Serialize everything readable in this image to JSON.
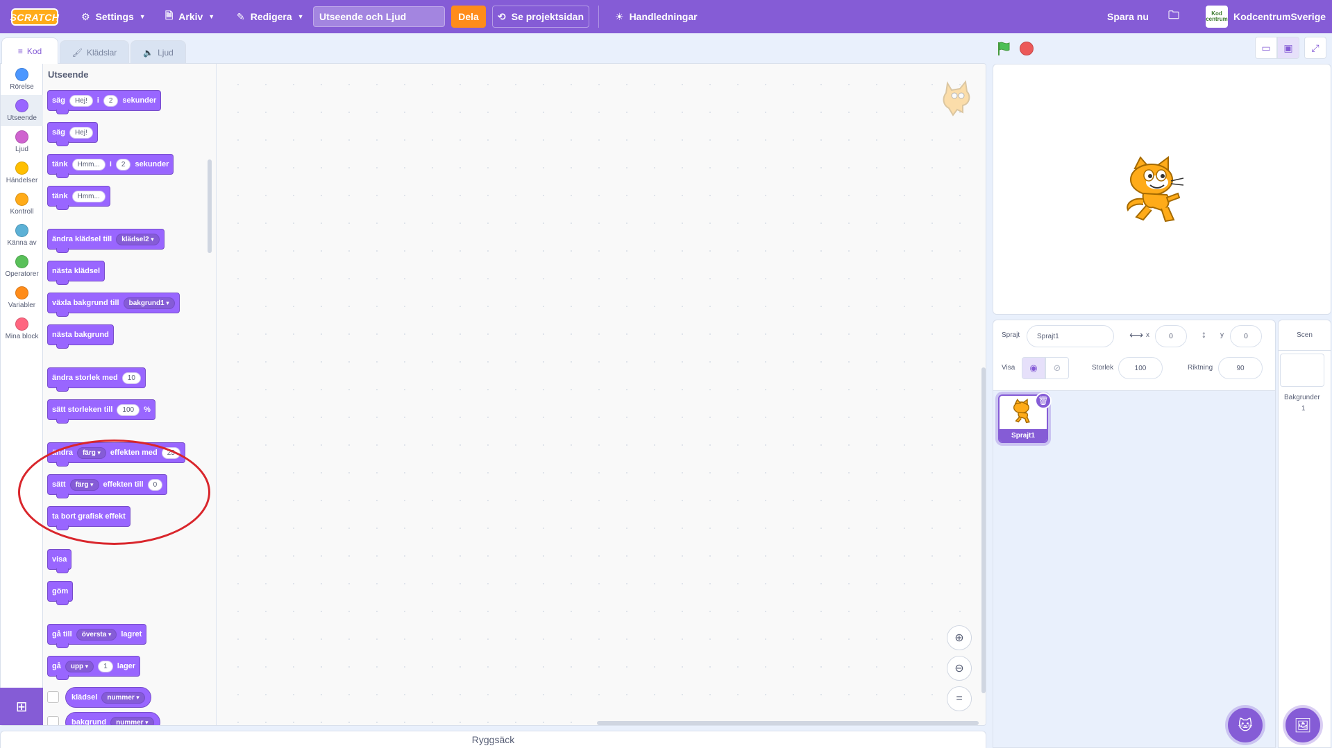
{
  "menubar": {
    "logo": "SCRATCH",
    "settings": "Settings",
    "file": "Arkiv",
    "edit": "Redigera",
    "project_title": "Utseende och Ljud",
    "share": "Dela",
    "see_project_page": "Se projektsidan",
    "tutorials": "Handledningar",
    "save_now": "Spara nu",
    "account_name": "KodcentrumSverige",
    "avatar_text": "Kod centrum"
  },
  "tabs": {
    "code": "Kod",
    "costumes": "Klädslar",
    "sounds": "Ljud"
  },
  "categories": [
    {
      "label": "Rörelse",
      "color": "#4c97ff"
    },
    {
      "label": "Utseende",
      "color": "#9966ff"
    },
    {
      "label": "Ljud",
      "color": "#cf63cf"
    },
    {
      "label": "Händelser",
      "color": "#ffbf00"
    },
    {
      "label": "Kontroll",
      "color": "#ffab19"
    },
    {
      "label": "Känna av",
      "color": "#5cb1d6"
    },
    {
      "label": "Operatorer",
      "color": "#59c059"
    },
    {
      "label": "Variabler",
      "color": "#ff8c1a"
    },
    {
      "label": "Mina block",
      "color": "#ff6680"
    }
  ],
  "flyout": {
    "title": "Utseende",
    "blocks": {
      "say_for": {
        "say": "säg",
        "msg": "Hej!",
        "in": "i",
        "secs": "2",
        "seconds": "sekunder"
      },
      "say": {
        "say": "säg",
        "msg": "Hej!"
      },
      "think_for": {
        "think": "tänk",
        "msg": "Hmm...",
        "in": "i",
        "secs": "2",
        "seconds": "sekunder"
      },
      "think": {
        "think": "tänk",
        "msg": "Hmm..."
      },
      "switch_costume": {
        "label": "ändra klädsel till",
        "value": "klädsel2"
      },
      "next_costume": {
        "label": "nästa klädsel"
      },
      "switch_backdrop": {
        "label": "växla bakgrund till",
        "value": "bakgrund1"
      },
      "next_backdrop": {
        "label": "nästa bakgrund"
      },
      "change_size": {
        "label": "ändra storlek med",
        "value": "10"
      },
      "set_size": {
        "label": "sätt storleken till",
        "value": "100",
        "unit": "%"
      },
      "change_effect": {
        "label": "ändra",
        "effect": "färg",
        "label2": "effekten med",
        "value": "25"
      },
      "set_effect": {
        "label": "sätt",
        "effect": "färg",
        "label2": "effekten till",
        "value": "0"
      },
      "clear_effects": {
        "label": "ta bort grafisk effekt"
      },
      "show": {
        "label": "visa"
      },
      "hide": {
        "label": "göm"
      },
      "go_to_layer": {
        "label": "gå till",
        "value": "översta",
        "label2": "lagret"
      },
      "go_layers": {
        "label": "gå",
        "value": "upp",
        "num": "1",
        "label2": "lager"
      },
      "costume_reporter": {
        "label": "klädsel",
        "value": "nummer"
      },
      "backdrop_reporter": {
        "label": "bakgrund",
        "value": "nummer"
      }
    }
  },
  "workspace": {
    "backpack": "Ryggsäck"
  },
  "sprite_info": {
    "sprite_label": "Sprajt",
    "sprite_name": "Sprajt1",
    "x_label": "x",
    "x_value": "0",
    "y_label": "y",
    "y_value": "0",
    "show_label": "Visa",
    "size_label": "Storlek",
    "size_value": "100",
    "direction_label": "Riktning",
    "direction_value": "90"
  },
  "sprites": [
    {
      "name": "Sprajt1"
    }
  ],
  "stage_target": {
    "header": "Scen",
    "backdrops_label": "Bakgrunder",
    "backdrops_count": "1"
  },
  "colors": {
    "accent": "#855cd6",
    "looks_block": "#9966ff",
    "annotation": "#d9262c"
  }
}
